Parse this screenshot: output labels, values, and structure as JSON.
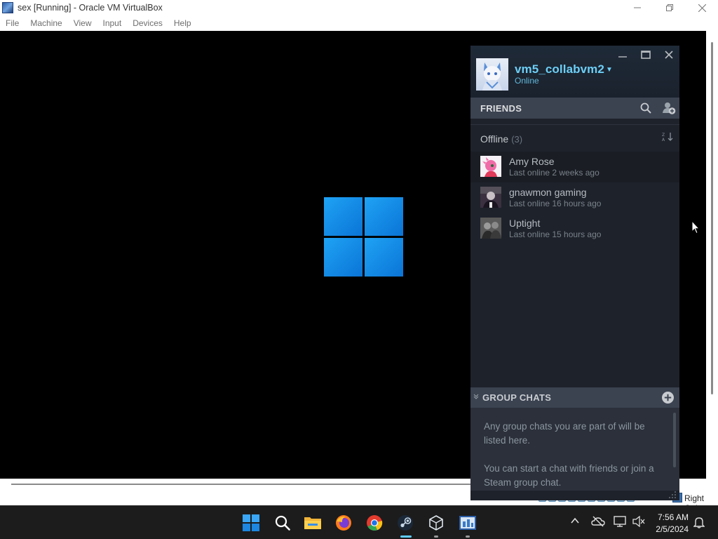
{
  "vbox": {
    "title": "sex [Running] - Oracle VM VirtualBox",
    "menu": [
      "File",
      "Machine",
      "View",
      "Input",
      "Devices",
      "Help"
    ],
    "host_key": "Right Ctrl"
  },
  "steam": {
    "user": {
      "name": "vm5_collabvm2",
      "status": "Online"
    },
    "friends_label": "FRIENDS",
    "offline_label": "Offline",
    "offline_count": "(3)",
    "friends": [
      {
        "name": "Amy Rose",
        "last_online": "Last online 2 weeks ago"
      },
      {
        "name": "gnawmon gaming",
        "last_online": "Last online 16 hours ago"
      },
      {
        "name": "Uptight",
        "last_online": "Last online 15 hours ago"
      }
    ],
    "group_chats_label": "GROUP CHATS",
    "group_chats_text_1": "Any group chats you are part of will be listed here.",
    "group_chats_text_2": "You can start a chat with friends or join a Steam group chat."
  },
  "taskbar": {
    "time": "7:56 AM",
    "date": "2/5/2024"
  },
  "colors": {
    "steam_accent": "#6dcff6",
    "steam_bg": "#1e222b",
    "taskbar_bg": "#1c1c1c"
  }
}
